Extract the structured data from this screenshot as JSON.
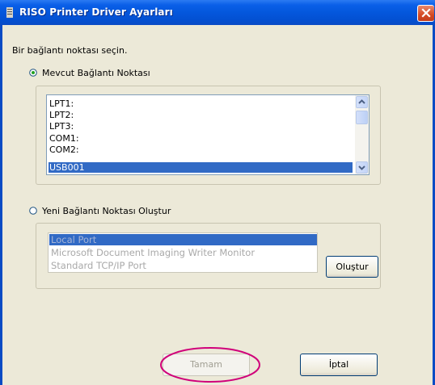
{
  "window": {
    "title": "RISO Printer Driver Ayarları"
  },
  "prompt": "Bir bağlantı noktası seçin.",
  "existing": {
    "label": "Mevcut Bağlantı Noktası",
    "selected": true,
    "ports": [
      "LPT1:",
      "LPT2:",
      "LPT3:",
      "COM1:",
      "COM2:",
      "USB001"
    ],
    "selected_port": "USB001"
  },
  "create": {
    "label": "Yeni Bağlantı Noktası Oluştur",
    "selected": false,
    "port_types": [
      "Local Port",
      "Microsoft Document Imaging Writer Monitor",
      "Standard TCP/IP Port"
    ],
    "selected_type": "Local Port",
    "button_label": "Oluştur"
  },
  "buttons": {
    "ok": "Tamam",
    "ok_enabled": false,
    "cancel": "İptal"
  },
  "colors": {
    "title_bar": "#0457dc",
    "selection": "#316ac5",
    "highlight_ellipse": "#d0007a"
  }
}
